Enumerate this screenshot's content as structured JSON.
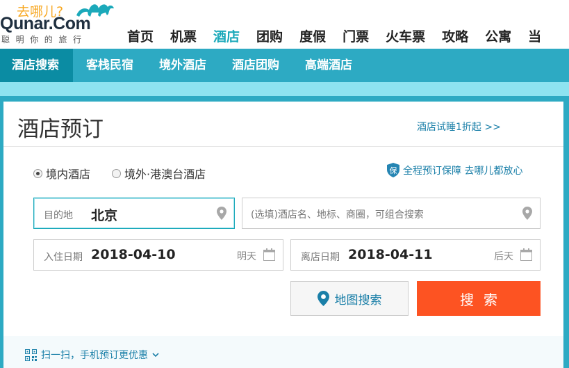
{
  "logo": {
    "slogan_cn": "去哪儿?",
    "wordmark": "Qunar.Com",
    "subtitle": "聪明你的旅行"
  },
  "main_nav": [
    "首页",
    "机票",
    "酒店",
    "团购",
    "度假",
    "门票",
    "火车票",
    "攻略",
    "公寓",
    "当"
  ],
  "main_nav_active": "酒店",
  "sub_nav": [
    "酒店搜索",
    "客栈民宿",
    "境外酒店",
    "酒店团购",
    "高端酒店"
  ],
  "sub_nav_active": "酒店搜索",
  "panel": {
    "title": "酒店预订",
    "trial_link": "酒店试睡1折起 >>",
    "radio_domestic": "境内酒店",
    "radio_overseas": "境外·港澳台酒店",
    "radio_selected": "境内酒店",
    "guarantee": "全程预订保障 去哪儿都放心",
    "guarantee_badge": "保"
  },
  "form": {
    "destination_label": "目的地",
    "destination_value": "北京",
    "keyword_placeholder": "(选填)酒店名、地标、商圈，可组合搜索",
    "checkin_label": "入住日期",
    "checkin_value": "2018-04-10",
    "checkin_hint": "明天",
    "checkout_label": "离店日期",
    "checkout_value": "2018-04-11",
    "checkout_hint": "后天"
  },
  "buttons": {
    "map_search": "地图搜索",
    "search": "搜索"
  },
  "qr": {
    "text": "扫一扫，手机预订更优惠"
  },
  "colors": {
    "accent": "#2daac3",
    "active_tab": "#0b8ca3",
    "band": "#8ee3f0",
    "search_button": "#fd5322",
    "link": "#1a7fa8",
    "logo_orange": "#f7a823"
  },
  "icons": [
    "camel-logo-icon",
    "location-pin-icon",
    "calendar-icon",
    "shield-icon",
    "map-pin-icon",
    "qr-code-icon",
    "chevron-down-icon"
  ]
}
